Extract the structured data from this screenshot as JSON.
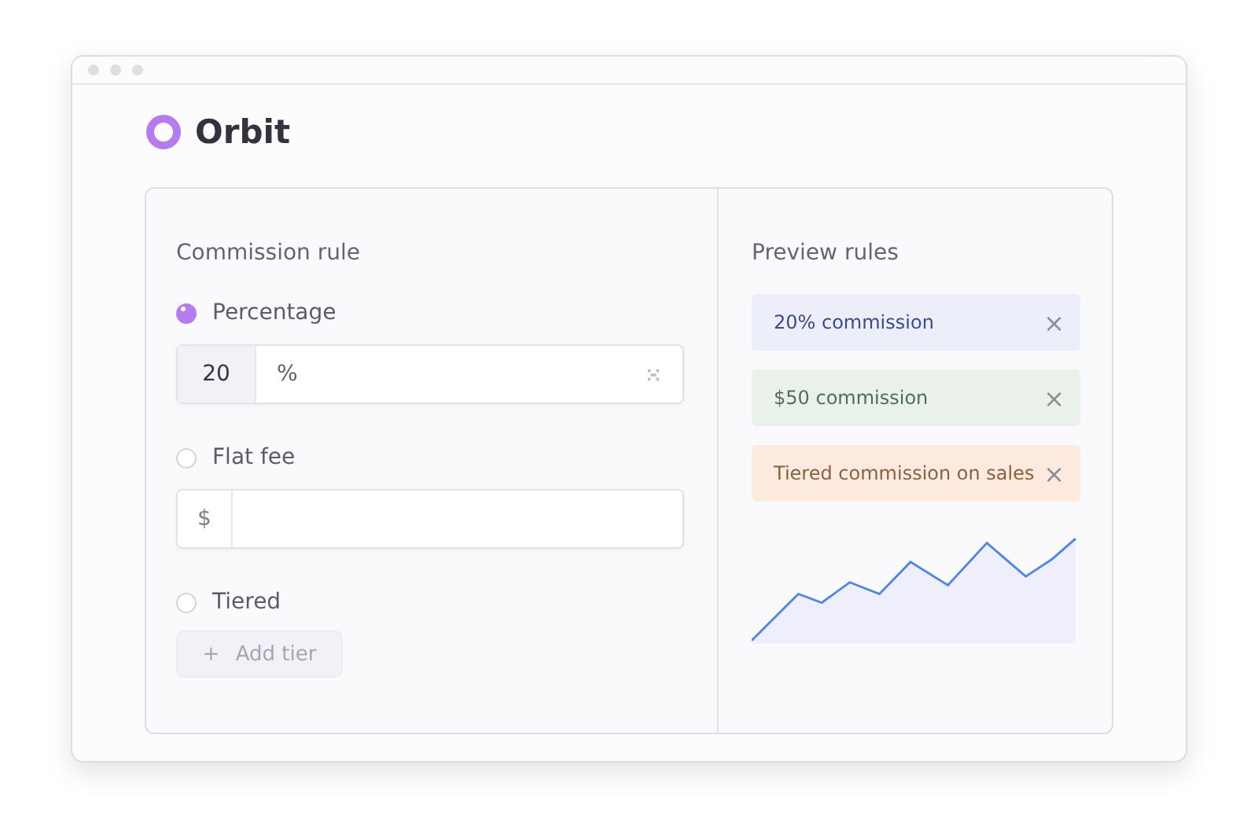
{
  "app": {
    "name": "Orbit"
  },
  "commission_rule": {
    "title": "Commission rule",
    "options": [
      {
        "kind": "percent",
        "label": "Percentage",
        "selected": true,
        "value": "20",
        "unit": "%"
      },
      {
        "kind": "flat",
        "label": "Flat fee",
        "selected": false,
        "prefix": "$"
      },
      {
        "kind": "tiered",
        "label": "Tiered",
        "selected": false,
        "button": "Add tier",
        "button_icon": "+"
      }
    ]
  },
  "preview": {
    "title": "Preview rules",
    "rules": [
      {
        "label": "20% commission",
        "color": "#eceefa"
      },
      {
        "label": "$50 commission",
        "color": "#e9f1ea"
      },
      {
        "label": "Tiered commission on sales",
        "color": "#fbeadd"
      }
    ],
    "close_glyph": "×"
  }
}
